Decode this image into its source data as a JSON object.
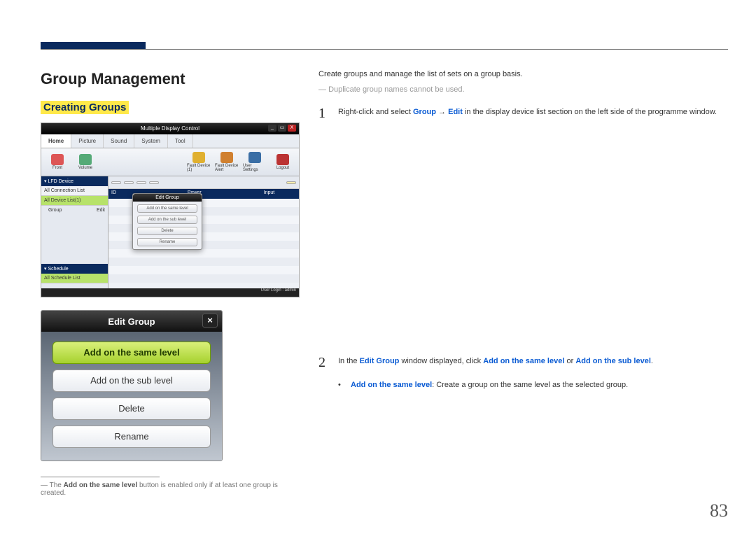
{
  "page_number": "83",
  "headings": {
    "main": "Group Management",
    "sub": "Creating Groups"
  },
  "shot1": {
    "window_title": "Multiple Display Control",
    "menus": {
      "home": "Home",
      "picture": "Picture",
      "sound": "Sound",
      "system": "System",
      "tool": "Tool"
    },
    "toolbar_left": {
      "front": "Front",
      "volume": "Volume"
    },
    "toolbar_right": {
      "fault_device1": "Fault Device (1)",
      "fault_device_alert": "Fault Device Alert",
      "user_settings": "User Settings",
      "logout": "Logout"
    },
    "sidebar": {
      "lfd_header": "▾ LFD Device",
      "all_conn": "All Connection List",
      "all_device": "All Device List(1)",
      "group_label": "Group",
      "group_edit": "Edit",
      "schedule_header": "▾ Schedule",
      "all_schedule": "All Schedule List"
    },
    "content_btns": {
      "b1": "",
      "b2": "",
      "b3": "",
      "b4": "",
      "b5": ""
    },
    "col_headers": {
      "c1": "ID",
      "c2": "",
      "c3": "Power",
      "c4": "",
      "c5": "Input"
    },
    "popup": {
      "title": "Edit Group",
      "opt1": "Add on the same level",
      "opt2": "Add on the sub level",
      "opt3": "Delete",
      "opt4": "Rename"
    },
    "footer": "User Login : admin"
  },
  "shot2": {
    "title": "Edit Group",
    "opt_same": "Add on the same level",
    "opt_sub": "Add on the sub level",
    "opt_delete": "Delete",
    "opt_rename": "Rename",
    "close": "×"
  },
  "footnote": {
    "prefix": "― The ",
    "bold": "Add on the same level",
    "suffix": " button is enabled only if at least one group is created."
  },
  "right": {
    "intro": "Create groups and manage the list of sets on a group basis.",
    "note": "Duplicate group names cannot be used.",
    "step1_num": "1",
    "step1_a": "Right-click and select ",
    "step1_b1": "Group",
    "step1_arrow": " → ",
    "step1_b2": "Edit",
    "step1_c": " in the display device list section on the left side of the programme window.",
    "step2_num": "2",
    "step2_a": "In the ",
    "step2_b1": "Edit Group",
    "step2_b": " window displayed, click ",
    "step2_b2": "Add on the same level",
    "step2_or": " or ",
    "step2_b3": "Add on the sub level",
    "step2_end": ".",
    "bullet_a1": "Add on the same level",
    "bullet_a2": ": Create a group on the same level as the selected group."
  }
}
